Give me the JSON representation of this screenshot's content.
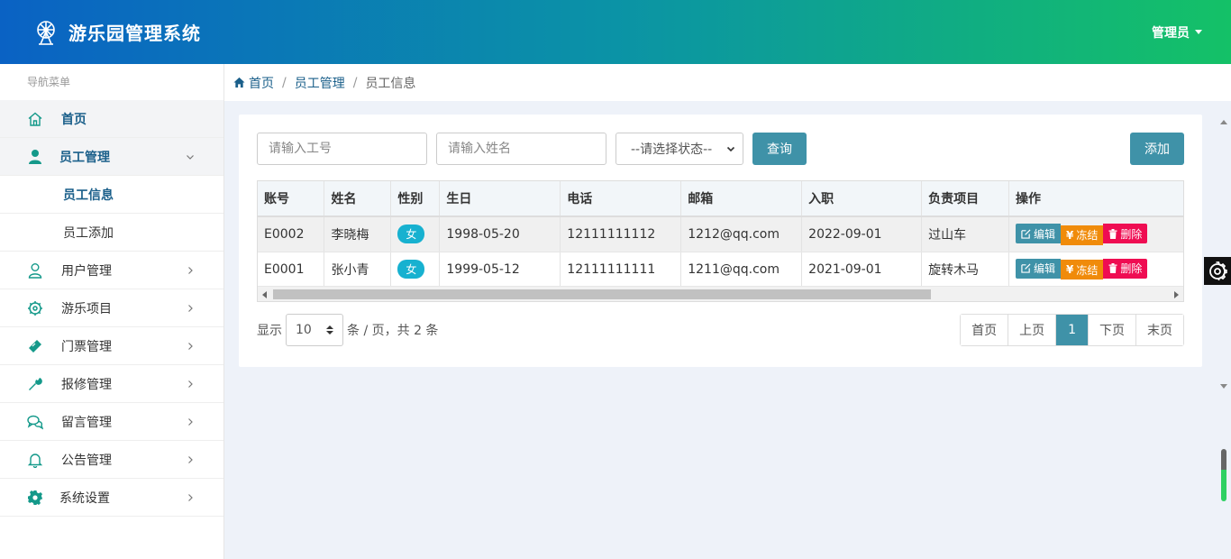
{
  "header": {
    "title": "游乐园管理系统",
    "user": "管理员"
  },
  "sidebar": {
    "caption": "导航菜单",
    "items": [
      {
        "label": "首页",
        "icon": "home-icon"
      },
      {
        "label": "员工管理",
        "icon": "user-icon",
        "children": [
          "员工信息",
          "员工添加"
        ]
      },
      {
        "label": "用户管理",
        "icon": "user-outline-icon"
      },
      {
        "label": "游乐项目",
        "icon": "gear-icon"
      },
      {
        "label": "门票管理",
        "icon": "ticket-icon"
      },
      {
        "label": "报修管理",
        "icon": "wrench-icon"
      },
      {
        "label": "留言管理",
        "icon": "chat-icon"
      },
      {
        "label": "公告管理",
        "icon": "bell-icon"
      },
      {
        "label": "系统设置",
        "icon": "cog-icon"
      }
    ]
  },
  "breadcrumb": {
    "home": "首页",
    "section": "员工管理",
    "current": "员工信息"
  },
  "toolbar": {
    "id_placeholder": "请输入工号",
    "name_placeholder": "请输入姓名",
    "status_select": "--请选择状态--",
    "query_label": "查询",
    "add_label": "添加"
  },
  "table": {
    "headers": [
      "账号",
      "姓名",
      "性别",
      "生日",
      "电话",
      "邮箱",
      "入职",
      "负责项目",
      "操作"
    ],
    "rows": [
      [
        "E0002",
        "李晓梅",
        "女",
        "1998-05-20",
        "12111111112",
        "1212@qq.com",
        "2022-09-01",
        "过山车"
      ],
      [
        "E0001",
        "张小青",
        "女",
        "1999-05-12",
        "12111111111",
        "1211@qq.com",
        "2021-09-01",
        "旋转木马"
      ]
    ],
    "actions": {
      "edit": "编辑",
      "freeze": "冻结",
      "delete": "删除"
    }
  },
  "pagination": {
    "show_label": "显示",
    "page_size": "10",
    "summary": "条 / 页，共 2 条",
    "first": "首页",
    "prev": "上页",
    "current": "1",
    "next": "下页",
    "last": "末页"
  },
  "colors": {
    "accent": "#3f92a8",
    "freeze": "#f08b0a",
    "delete": "#ef0d52",
    "badge": "#17b1d0"
  }
}
